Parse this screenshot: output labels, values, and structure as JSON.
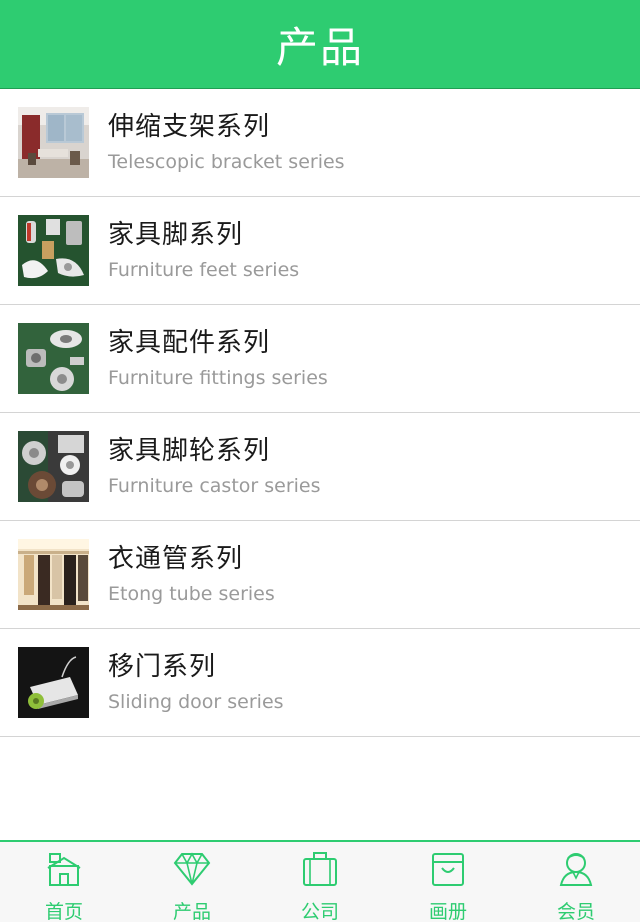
{
  "header": {
    "title": "产品"
  },
  "products": [
    {
      "title": "伸缩支架系列",
      "subtitle": "Telescopic bracket series",
      "thumb": "living-room"
    },
    {
      "title": "家具脚系列",
      "subtitle": "Furniture feet series",
      "thumb": "furniture-feet"
    },
    {
      "title": "家具配件系列",
      "subtitle": "Furniture fittings series",
      "thumb": "fittings"
    },
    {
      "title": "家具脚轮系列",
      "subtitle": "Furniture castor series",
      "thumb": "castors"
    },
    {
      "title": "衣通管系列",
      "subtitle": "Etong tube series",
      "thumb": "wardrobe"
    },
    {
      "title": "移门系列",
      "subtitle": "Sliding door series",
      "thumb": "sliding-door"
    }
  ],
  "tabbar": {
    "home": "首页",
    "products": "产品",
    "company": "公司",
    "album": "画册",
    "member": "会员"
  },
  "colors": {
    "accent": "#2ecc71"
  }
}
